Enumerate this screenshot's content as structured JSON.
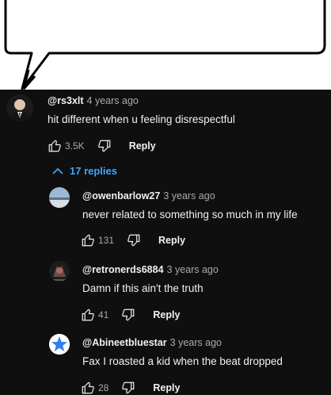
{
  "top_comment": {
    "handle": "@rs3xlt",
    "time": "4 years ago",
    "text": "hit different when u feeling disrespectful",
    "likes": "3.5K",
    "reply_label": "Reply"
  },
  "replies_toggle": {
    "label": "17 replies",
    "icon": "chevron-up-icon",
    "color": "#3ea6ff"
  },
  "replies": [
    {
      "handle": "@owenbarlow27",
      "time": "3 years ago",
      "text": "never related to something so much in my life",
      "likes": "131",
      "reply_label": "Reply"
    },
    {
      "handle": "@retronerds6884",
      "time": "3 years ago",
      "text": "Damn if this ain't the truth",
      "likes": "41",
      "reply_label": "Reply"
    },
    {
      "handle": "@Abineetbluestar",
      "time": "3 years ago",
      "text": "Fax I roasted a kid when the beat dropped",
      "likes": "28",
      "reply_label": "Reply"
    }
  ],
  "colors": {
    "background": "#0f0f0f",
    "text": "#f1f1f1",
    "muted": "#aaaaaa",
    "link": "#3ea6ff"
  }
}
